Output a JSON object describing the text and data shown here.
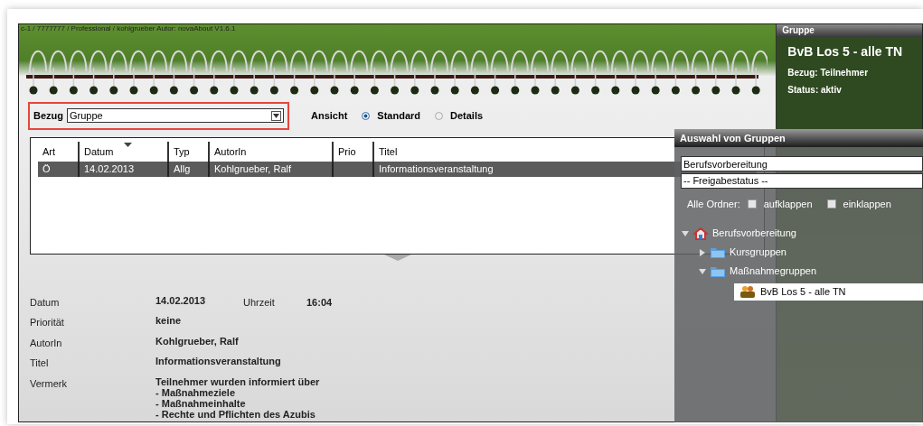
{
  "app_title": "c-1 / 7777777 / Professional / kohlgrueber Autor: novaAbout V1.6.1",
  "filter": {
    "label": "Bezug",
    "value": "Gruppe"
  },
  "view": {
    "label": "Ansicht",
    "options": [
      {
        "label": "Standard",
        "selected": true
      },
      {
        "label": "Details",
        "selected": false
      }
    ]
  },
  "table": {
    "columns": [
      {
        "label": "Art",
        "sorted": false
      },
      {
        "label": "Datum",
        "sorted": true
      },
      {
        "label": "Typ",
        "sorted": false
      },
      {
        "label": "AutorIn",
        "sorted": false
      },
      {
        "label": "Prio",
        "sorted": false
      },
      {
        "label": "Titel",
        "sorted": false
      }
    ],
    "rows": [
      {
        "cells": [
          "Ö",
          "14.02.2013",
          "Allg",
          "Kohlgrueber, Ralf",
          null,
          "Informationsveranstaltung"
        ],
        "selected": true
      }
    ]
  },
  "details": [
    {
      "label": "Datum",
      "value": "14.02.2013",
      "extra_label": "Uhrzeit",
      "extra_value": "16:04"
    },
    {
      "label": "Priorität",
      "value": "keine"
    },
    {
      "label": "AutorIn",
      "value": "Kohlgrueber, Ralf"
    },
    {
      "label": "Titel",
      "value": "Informationsveranstaltung"
    },
    {
      "label": "Vermerk",
      "value": "Teilnehmer wurden informiert über\n- Maßnahmeziele\n- Maßnahmeinhalte\n- Rechte und Pflichten des Azubis"
    }
  ],
  "group_panel": {
    "header": "Gruppe",
    "name": "BvB Los 5 - alle TN",
    "lines": [
      "Bezug: Teilnehmer",
      "Status: aktiv"
    ]
  },
  "picker": {
    "title": "Auswahl von Gruppen",
    "search": {
      "value": "Berufsvorbereitung"
    },
    "status_select": {
      "value": "-- Freigabestatus --"
    },
    "folders_label": "Alle Ordner:",
    "folder_options": [
      {
        "label": "aufklappen",
        "checked": false
      },
      {
        "label": "einklappen",
        "checked": false
      }
    ],
    "tree": [
      {
        "label": "Berufsvorbereitung",
        "kind": "home",
        "expanded": true,
        "selected": false,
        "children": [
          {
            "label": "Kursgruppen",
            "kind": "folder",
            "expanded": false,
            "selected": false
          },
          {
            "label": "Maßnahmegruppen",
            "kind": "folder",
            "expanded": true,
            "selected": false,
            "children": [
              {
                "label": "BvB Los 5 - alle TN",
                "kind": "group",
                "selected": true
              }
            ]
          }
        ]
      }
    ]
  }
}
